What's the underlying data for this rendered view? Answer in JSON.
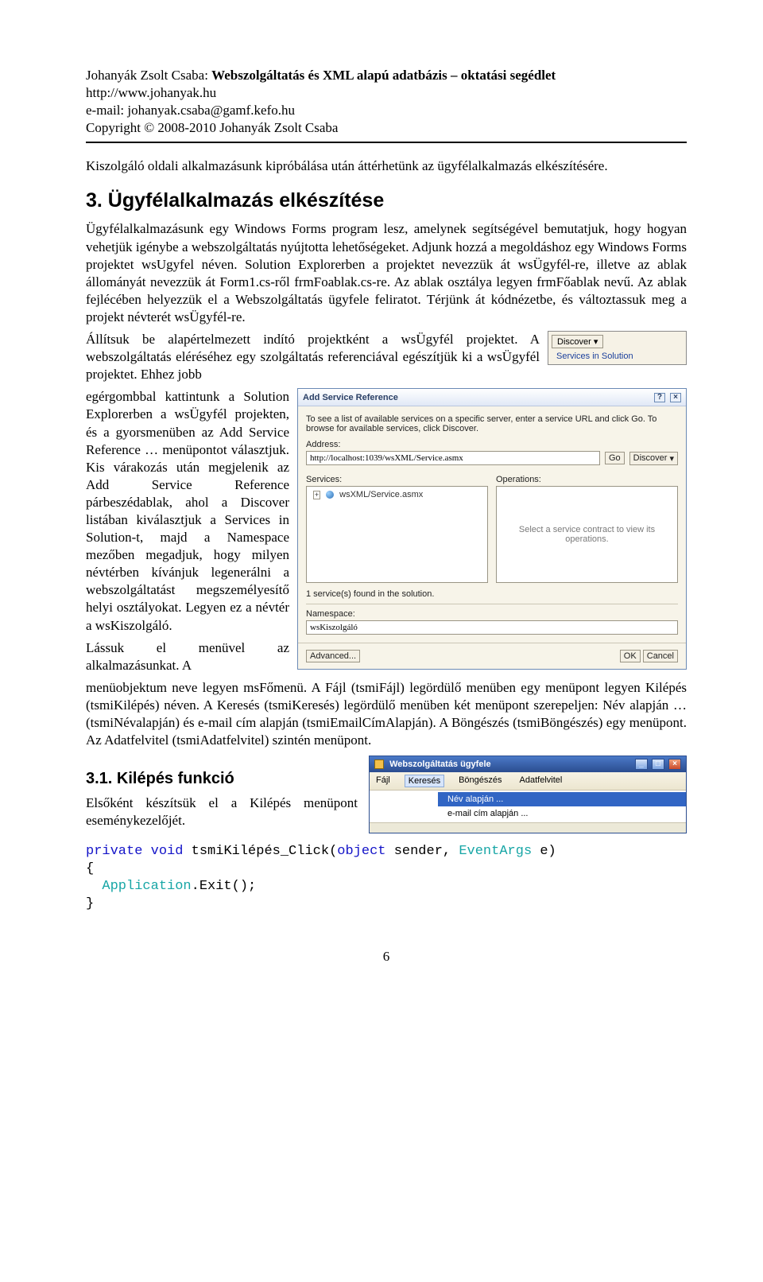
{
  "header": {
    "author": "Johanyák Zsolt Csaba:",
    "title": "Webszolgáltatás és XML alapú adatbázis – oktatási segédlet",
    "url": "http://www.johanyak.hu",
    "email_label": "e-mail:",
    "email": "johanyak.csaba@gamf.kefo.hu",
    "copyright": "Copyright © 2008-2010 Johanyák Zsolt Csaba"
  },
  "paragraphs": {
    "intro": "Kiszolgáló oldali alkalmazásunk kipróbálása után áttérhetünk az ügyfélalkalmazás elkészítésére.",
    "h2": "3. Ügyfélalkalmazás elkészítése",
    "p1": "Ügyfélalkalmazásunk egy Windows Forms program lesz, amelynek segítségével bemutatjuk, hogy hogyan vehetjük igénybe a webszolgáltatás nyújtotta lehetőségeket. Adjunk hozzá a megoldáshoz egy Windows Forms projektet wsUgyfel néven. Solution Explorerben a projektet nevezzük át wsÜgyfél-re, illetve az ablak állományát nevezzük át Form1.cs-ről frmFoablak.cs-re. Az ablak osztálya legyen frmFőablak nevű. Az ablak fejlécében helyezzük el a Webszolgáltatás ügyfele feliratot. Térjünk át kódnézetbe, és változtassuk meg a projekt névterét wsÜgyfél-re.",
    "p2a": "Állítsuk be alapértelmezett indító projektként a wsÜgyfél projektet. A webszolgáltatás eléréséhez egy szolgáltatás referenciával egészítjük ki a wsÜgyfél projektet. Ehhez jobb",
    "p2b": "egérgombbal kattintunk a Solution Explorerben a wsÜgyfél projekten, és a gyorsmenüben az Add Service Reference … menüpontot választjuk. Kis várakozás után megjelenik az Add Service Reference párbeszédablak, ahol a Discover listában kiválasztjuk a Services in Solution-t, majd a Namespace mezőben megadjuk, hogy milyen névtérben kívánjuk legenerálni a webszolgáltatást megszemélyesítő helyi osztályokat. Legyen ez a névtér a wsKiszolgáló.",
    "p2c": "Lássuk el menüvel az alkalmazásunkat. A",
    "p3": "menüobjektum neve legyen msFőmenü. A Fájl (tsmiFájl) legördülő menüben egy menüpont legyen Kilépés (tsmiKilépés) néven. A Keresés (tsmiKeresés) legördülő menüben két menüpont szerepeljen: Név alapján … (tsmiNévalapján) és e-mail cím alapján (tsmiEmailCímAlapján). A Böngészés (tsmiBöngészés) egy menüpont. Az Adatfelvitel (tsmiAdatfelvitel) szintén menüpont.",
    "h3": "3.1. Kilépés funkció",
    "p4": "Elsőként készítsük el a Kilépés menüpont eseménykezelőjét."
  },
  "small_img": {
    "button": "Discover",
    "link": "Services in Solution"
  },
  "asr": {
    "title": "Add Service Reference",
    "help": "?",
    "close": "×",
    "desc": "To see a list of available services on a specific server, enter a service URL and click Go. To browse for available services, click Discover.",
    "address_label": "Address:",
    "address_value": "http://localhost:1039/wsXML/Service.asmx",
    "go": "Go",
    "discover": "Discover",
    "services_label": "Services:",
    "operations_label": "Operations:",
    "tree_item": "wsXML/Service.asmx",
    "ops_placeholder": "Select a service contract to view its operations.",
    "found": "1 service(s) found in the solution.",
    "namespace_label": "Namespace:",
    "namespace_value": "wsKiszolgáló",
    "advanced": "Advanced...",
    "ok": "OK",
    "cancel": "Cancel"
  },
  "winmenu": {
    "app_title": "Webszolgáltatás ügyfele",
    "min": "_",
    "max": "□",
    "close": "×",
    "items": [
      "Fájl",
      "Keresés",
      "Böngészés",
      "Adatfelvitel"
    ],
    "sub": [
      "Név alapján ...",
      "e-mail cím alapján ..."
    ]
  },
  "code": {
    "kw_private": "private",
    "kw_void": "void",
    "method": " tsmiKilépés_Click(",
    "kw_object": "object",
    "arg1": " sender, ",
    "type_event": "EventArgs",
    "argend": " e)",
    "brace_open": "{",
    "app": "Application",
    "call": ".Exit();",
    "brace_close": "}"
  },
  "pagenum": "6"
}
